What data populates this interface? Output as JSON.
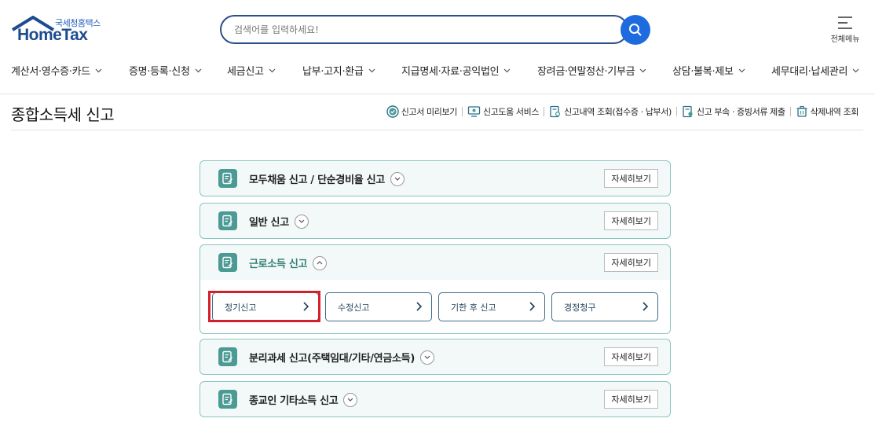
{
  "header": {
    "logo_sub": "국세청홈택스",
    "logo_main": "HomeTax",
    "search_placeholder": "검색어를 입력하세요!",
    "menu_all_label": "전체메뉴"
  },
  "gnb": [
    {
      "label": "계산서·영수증·카드"
    },
    {
      "label": "증명·등록·신청"
    },
    {
      "label": "세금신고"
    },
    {
      "label": "납부·고지·환급"
    },
    {
      "label": "지급명세·자료·공익법인"
    },
    {
      "label": "장려금·연말정산·기부금"
    },
    {
      "label": "상담·불복·제보"
    },
    {
      "label": "세무대리·납세관리"
    }
  ],
  "page": {
    "title": "종합소득세 신고"
  },
  "quick_links": [
    {
      "label": "신고서 미리보기",
      "icon": "check-circle-icon"
    },
    {
      "label": "신고도움 서비스",
      "icon": "monitor-help-icon"
    },
    {
      "label": "신고내역 조회(접수증 · 납부서)",
      "icon": "document-search-icon"
    },
    {
      "label": "신고 부속 · 증빙서류 제출",
      "icon": "document-upload-icon"
    },
    {
      "label": "삭제내역 조회",
      "icon": "trash-icon"
    }
  ],
  "accordions": [
    {
      "title": "모두채움 신고 / 단순경비율 신고",
      "detail": "자세히보기",
      "open": false
    },
    {
      "title": "일반 신고",
      "detail": "자세히보기",
      "open": false
    },
    {
      "title": "근로소득 신고",
      "detail": "자세히보기",
      "open": true
    },
    {
      "title": "분리과세 신고(주택임대/기타/연금소득)",
      "detail": "자세히보기",
      "open": false
    },
    {
      "title": "종교인 기타소득 신고",
      "detail": "자세히보기",
      "open": false
    }
  ],
  "sub_buttons": [
    {
      "label": "정기신고"
    },
    {
      "label": "수정신고"
    },
    {
      "label": "기한 후 신고"
    },
    {
      "label": "경정청구"
    }
  ],
  "colors": {
    "accent_teal": "#4b9a94",
    "brand_blue": "#1e6be0",
    "highlight_red": "#d4202a"
  }
}
